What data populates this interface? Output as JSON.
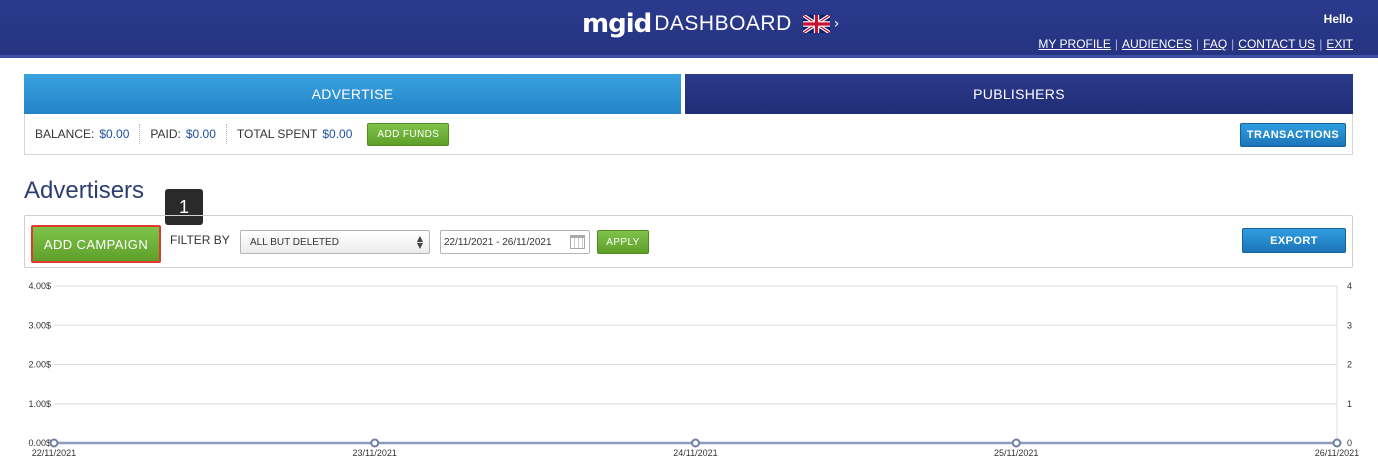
{
  "header": {
    "logo_mgid": "mgid",
    "logo_dashboard": "DASHBOARD",
    "lang_chevron": "›",
    "hello": "Hello",
    "nav": [
      "MY PROFILE",
      "AUDIENCES",
      "FAQ",
      "CONTACT US",
      "EXIT"
    ]
  },
  "tabs": {
    "advertise": "ADVERTISE",
    "publishers": "PUBLISHERS"
  },
  "balance": {
    "balance_label": "BALANCE:",
    "balance_value": "$0.00",
    "paid_label": "PAID:",
    "paid_value": "$0.00",
    "spent_label": "TOTAL SPENT",
    "spent_value": "$0.00",
    "add_funds": "ADD FUNDS",
    "transactions": "TRANSACTIONS"
  },
  "page": {
    "title": "Advertisers",
    "step_badge": "1"
  },
  "filter": {
    "add_campaign": "ADD CAMPAIGN",
    "filter_by": "FILTER BY",
    "status_selected": "ALL BUT DELETED",
    "date_range": "22/11/2021 - 26/11/2021",
    "apply": "APPLY",
    "export": "EXPORT"
  },
  "colors": {
    "header_bg": "#2c3a8e",
    "advertise_tab": "#2d93d6",
    "publishers_tab": "#253381",
    "green": "#6fb33a",
    "highlight_border": "#e03a2e",
    "chart_line": "#8d9bbd"
  },
  "chart_data": {
    "type": "line",
    "x": [
      "22/11/2021",
      "23/11/2021",
      "24/11/2021",
      "25/11/2021",
      "26/11/2021"
    ],
    "left_ticks": [
      "4.00$",
      "3.00$",
      "2.00$",
      "1.00$",
      "0.00$"
    ],
    "right_ticks": [
      "4",
      "3",
      "2",
      "1",
      "0"
    ],
    "series": [
      {
        "values": [
          0,
          0,
          0,
          0,
          0
        ]
      }
    ],
    "ylim": [
      0,
      4
    ],
    "grid": true
  }
}
